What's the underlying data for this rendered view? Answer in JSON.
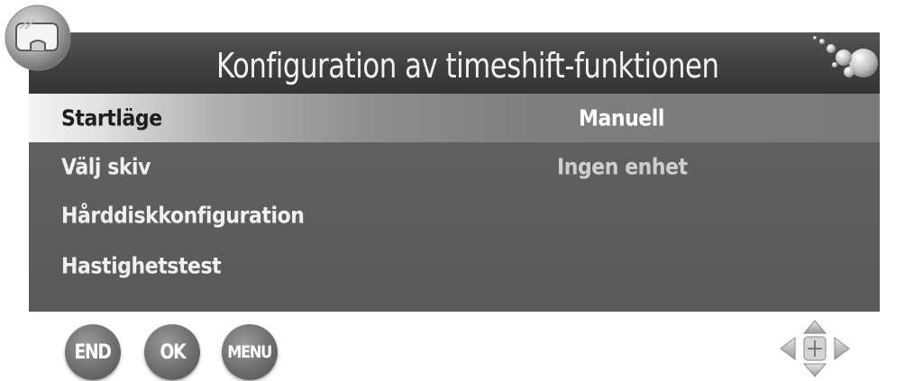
{
  "header": {
    "title": "Konfiguration av timeshift-funktionen"
  },
  "menu": {
    "items": [
      {
        "label": "Startläge",
        "value": "Manuell",
        "selected": true
      },
      {
        "label": "Välj skiv",
        "value": "Ingen enhet",
        "selected": false
      },
      {
        "label": "Hårddiskkonfiguration",
        "value": "",
        "selected": false
      },
      {
        "label": "Hastighetstest",
        "value": "",
        "selected": false
      }
    ]
  },
  "buttons": {
    "end_label": "END",
    "ok_label": "OK",
    "menu_label": "MENU"
  },
  "icons": {
    "corner": "hard-disk-icon",
    "decoration": "bubbles-icon",
    "navigation": "direction-arrows-icon"
  },
  "colors": {
    "title_bar": "#3e3e3e",
    "panel": "#606060",
    "selected_row": "#e2e2e2",
    "button": "#6e6e6e"
  }
}
